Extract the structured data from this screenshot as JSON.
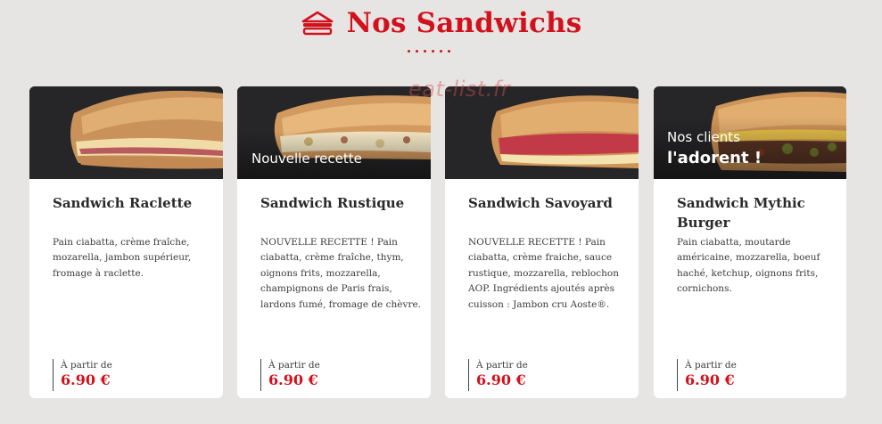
{
  "header": {
    "title": "Nos Sandwichs",
    "icon": "sandwich-icon",
    "accent": "#d1121c"
  },
  "watermark": "eat-list.fr",
  "cards": [
    {
      "title": "Sandwich Raclette",
      "description": "Pain ciabatta, crème fraîche, mozarella, jambon supérieur, fromage à raclette.",
      "price_label": "À partir de",
      "price": "6.90 €"
    },
    {
      "title": "Sandwich Rustique",
      "tag": "Nouvelle recette",
      "description": "NOUVELLE RECETTE ! Pain ciabatta, crème fraîche, thym, oignons frits, mozzarella, champignons de Paris frais, lardons fumé, fromage de chèvre.",
      "price_label": "À partir de",
      "price": "6.90 €"
    },
    {
      "title": "Sandwich Savoyard",
      "description": "NOUVELLE RECETTE ! Pain ciabatta, crème fraiche, sauce rustique, mozzarella, reblochon AOP. Ingrédients ajoutés après cuisson : Jambon cru Aoste®.",
      "price_label": "À partir de",
      "price": "6.90 €"
    },
    {
      "title": "Sandwich Mythic Burger",
      "tag_line1": "Nos clients",
      "tag_line2": "l'adorent !",
      "description": "Pain ciabatta, moutarde américaine, mozzarella, boeuf haché, ketchup, oignons frits, cornichons.",
      "price_label": "À partir de",
      "price": "6.90 €"
    }
  ]
}
